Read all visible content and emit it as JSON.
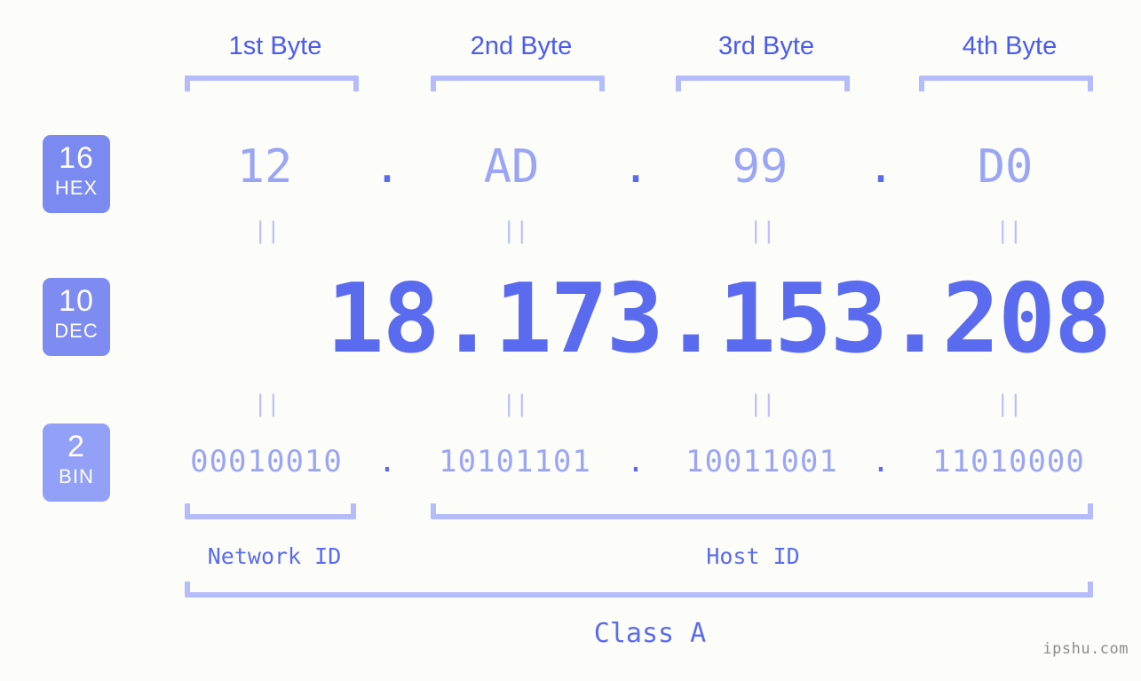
{
  "background_color": "#fcfdf8",
  "accent_color": "#5a6bef",
  "accent_light_color": "#9aa6f5",
  "bracket_color": "#b4bcfb",
  "badge_color": "#7b8af0",
  "header": {
    "bytes": [
      {
        "label": "1st Byte"
      },
      {
        "label": "2nd Byte"
      },
      {
        "label": "3rd Byte"
      },
      {
        "label": "4th Byte"
      }
    ]
  },
  "bases": {
    "hex": {
      "number": "16",
      "name": "HEX"
    },
    "dec": {
      "number": "10",
      "name": "DEC"
    },
    "bin": {
      "number": "2",
      "name": "BIN"
    }
  },
  "separator": ".",
  "equals_mark": "||",
  "rows": {
    "hex": {
      "values": [
        "12",
        "AD",
        "99",
        "D0"
      ]
    },
    "dec": {
      "values": [
        "18",
        "173",
        "153",
        "208"
      ],
      "full": "18.173.153.208"
    },
    "bin": {
      "values": [
        "00010010",
        "10101101",
        "10011001",
        "11010000"
      ]
    }
  },
  "footer": {
    "network_id_label": "Network ID",
    "host_id_label": "Host ID",
    "class_label": "Class A",
    "watermark": "ipshu.com"
  }
}
